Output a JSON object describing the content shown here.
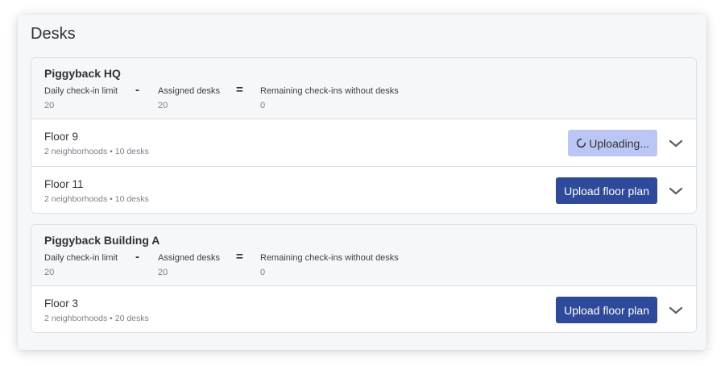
{
  "page": {
    "title": "Desks"
  },
  "buildings": [
    {
      "name": "Piggyback HQ",
      "stats": {
        "limit_label": "Daily check-in limit",
        "limit_value": "20",
        "minus": "-",
        "assigned_label": "Assigned desks",
        "assigned_value": "20",
        "equals": "=",
        "remaining_label": "Remaining check-ins without desks",
        "remaining_value": "0"
      },
      "floors": [
        {
          "name": "Floor 9",
          "meta": "2 neighborhoods • 10 desks",
          "button_label": "Uploading...",
          "button_state": "uploading"
        },
        {
          "name": "Floor 11",
          "meta": "2 neighborhoods • 10 desks",
          "button_label": "Upload floor plan",
          "button_state": "ready"
        }
      ]
    },
    {
      "name": "Piggyback Building A",
      "stats": {
        "limit_label": "Daily check-in limit",
        "limit_value": "20",
        "minus": "-",
        "assigned_label": "Assigned desks",
        "assigned_value": "20",
        "equals": "=",
        "remaining_label": "Remaining check-ins without desks",
        "remaining_value": "0"
      },
      "floors": [
        {
          "name": "Floor 3",
          "meta": "2 neighborhoods • 20 desks",
          "button_label": "Upload floor plan",
          "button_state": "ready"
        }
      ]
    }
  ],
  "icons": {
    "expand": "chevron-down-icon",
    "loading": "spinner-icon"
  },
  "colors": {
    "primary_button": "#2f4a9a",
    "uploading_button": "#bcc6f4",
    "panel_background": "#f6f7f9",
    "border": "#dcdfe4"
  }
}
